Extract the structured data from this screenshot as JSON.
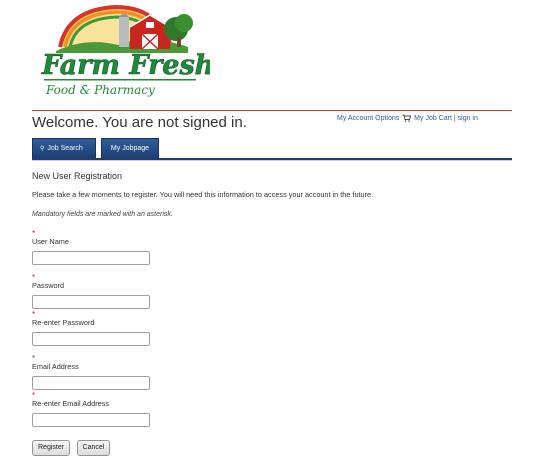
{
  "brand": {
    "logo_line1": "Farm Fresh",
    "logo_line2": "Food & Pharmacy",
    "colors": {
      "green": "#1f8a3a",
      "red": "#c8261f",
      "sky": "#f2c43a",
      "navy": "#1e3f73"
    }
  },
  "header": {
    "welcome": "Welcome. You are not signed in.",
    "account_options": "My Account Options",
    "job_cart": "My Job Cart",
    "separator": "|",
    "sign_in": "sign in",
    "cart_icon": "cart-icon"
  },
  "tabs": [
    {
      "label": "Job Search",
      "icon": "search-icon"
    },
    {
      "label": "My Jobpage"
    }
  ],
  "form": {
    "title": "New User Registration",
    "intro": "Please take a few moments to register. You will need this information to access your account in the future.",
    "mandatory_note": "Mandatory fields are marked with an asterisk.",
    "required_mark": "*",
    "fields": [
      {
        "label": "User Name",
        "value": ""
      },
      {
        "label": "Password",
        "value": ""
      },
      {
        "label": "Re-enter Password",
        "value": ""
      },
      {
        "label": "Email Address",
        "value": ""
      },
      {
        "label": "Re-enter Email Address",
        "value": ""
      }
    ],
    "register_label": "Register",
    "cancel_label": "Cancel"
  }
}
